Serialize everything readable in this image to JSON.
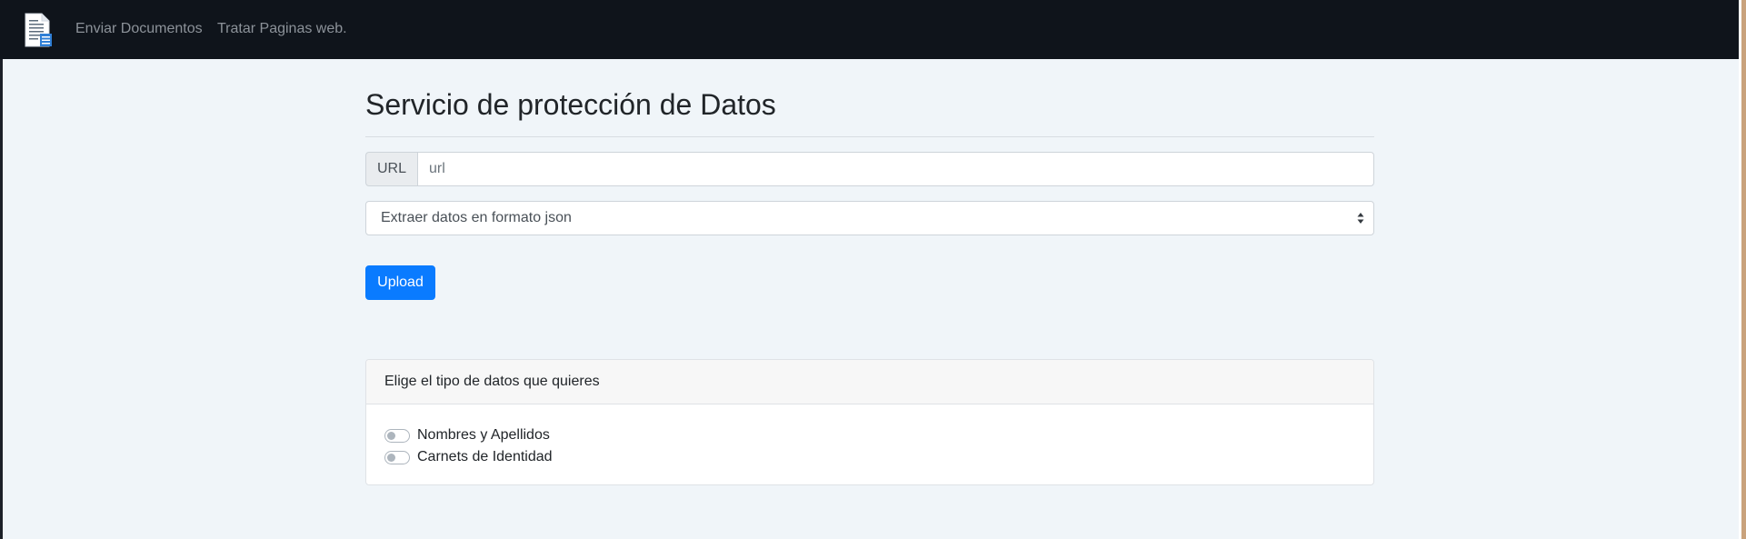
{
  "navbar": {
    "logo_icon": "document-icon",
    "links": [
      {
        "label": "Enviar Documentos"
      },
      {
        "label": "Tratar Paginas web."
      }
    ]
  },
  "main": {
    "title": "Servicio de protección de Datos",
    "url_field": {
      "prefix": "URL",
      "value": "",
      "placeholder": "url"
    },
    "format_select": {
      "selected": "Extraer datos en formato json",
      "icon": "select-arrows-icon"
    },
    "upload_button": {
      "label": "Upload"
    },
    "data_types_card": {
      "header": "Elige el tipo de datos que quieres",
      "options": [
        {
          "label": "Nombres y Apellidos",
          "checked": false
        },
        {
          "label": "Carnets de Identidad",
          "checked": false
        }
      ]
    }
  },
  "colors": {
    "navbar_bg": "#0f141b",
    "page_bg": "#f0f5f9",
    "primary": "#0a7bff",
    "nav_link": "#8c9299"
  }
}
